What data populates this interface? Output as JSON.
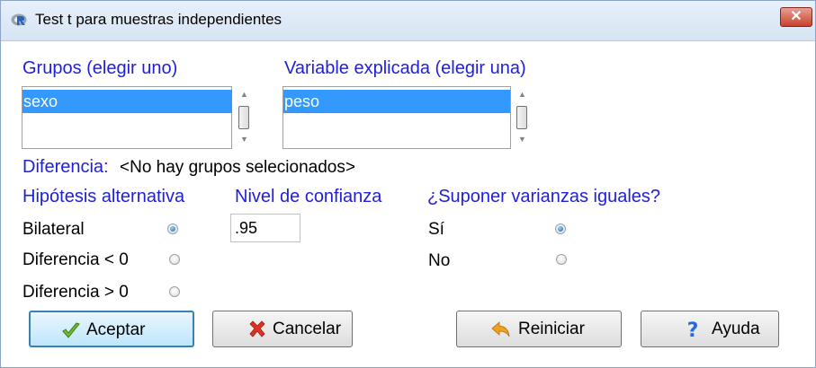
{
  "window": {
    "title": "Test t para muestras independientes"
  },
  "groups": {
    "label": "Grupos (elegir uno)",
    "items": [
      "sexo"
    ]
  },
  "response": {
    "label": "Variable explicada (elegir una)",
    "items": [
      "peso"
    ]
  },
  "difference": {
    "label": "Diferencia:",
    "value": "<No hay grupos selecionados>"
  },
  "alternative": {
    "label": "Hipótesis alternativa",
    "options": [
      "Bilateral",
      "Diferencia < 0",
      "Diferencia > 0"
    ],
    "selected": "Bilateral"
  },
  "confidence": {
    "label": "Nivel de confianza",
    "value": ".95"
  },
  "variances": {
    "label": "¿Suponer varianzas iguales?",
    "options": [
      "Sí",
      "No"
    ],
    "selected": "Sí"
  },
  "buttons": {
    "ok": "Aceptar",
    "cancel": "Cancelar",
    "reset": "Reiniciar",
    "help": "Ayuda"
  },
  "colors": {
    "label_blue": "#2020d8",
    "selection": "#3399ff",
    "default_button": "#bee6fd"
  }
}
